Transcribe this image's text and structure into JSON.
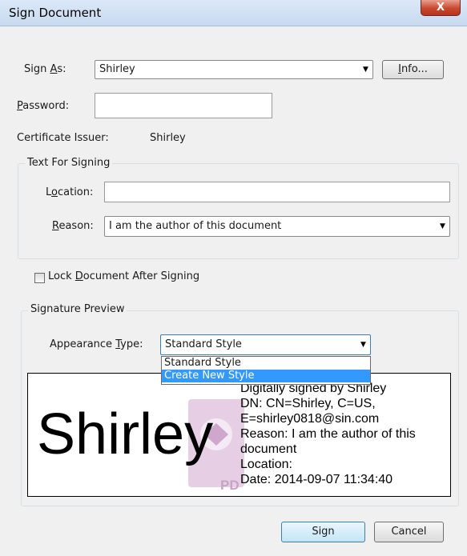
{
  "window": {
    "title": "Sign Document",
    "close_glyph": "X"
  },
  "sign_as": {
    "label_pre": "Sign ",
    "label_u": "A",
    "label_post": "s:",
    "value": "Shirley",
    "info_pre": "",
    "info_u": "I",
    "info_post": "nfo..."
  },
  "password": {
    "label_u": "P",
    "label_post": "assword:",
    "value": ""
  },
  "certificate": {
    "label": "Certificate Issuer:",
    "value": "Shirley"
  },
  "text_for_signing": {
    "title": "Text For Signing",
    "location_pre": "L",
    "location_u": "o",
    "location_post": "cation:",
    "location_value": "",
    "reason_u": "R",
    "reason_post": "eason:",
    "reason_value": "I am the author of this document"
  },
  "lock": {
    "pre": "Lock ",
    "u": "D",
    "post": "ocument After Signing",
    "checked": false
  },
  "signature_preview": {
    "title": "Signature Preview",
    "appearance_pre": "Appearance ",
    "appearance_u": "T",
    "appearance_post": "ype:",
    "appearance_value": "Standard Style",
    "options": [
      "Standard Style",
      "Create New Style"
    ],
    "highlighted": "Create New Style",
    "name": "Shirley",
    "details": [
      "Digitally signed by Shirley",
      "DN: CN=Shirley, C=US,",
      "E=shirley0818@sin.com",
      "Reason: I am the author of this",
      "document",
      "Location:",
      "Date: 2014-09-07 11:34:40"
    ],
    "watermark_text": "PD"
  },
  "buttons": {
    "sign": "Sign",
    "cancel": "Cancel"
  },
  "icons": {
    "dropdown": "chevron-down-icon",
    "watermark": "pdf-logo-watermark"
  },
  "colors": {
    "selection": "#3399ff",
    "close": "#c9482f",
    "watermark": "#b87bb4"
  }
}
